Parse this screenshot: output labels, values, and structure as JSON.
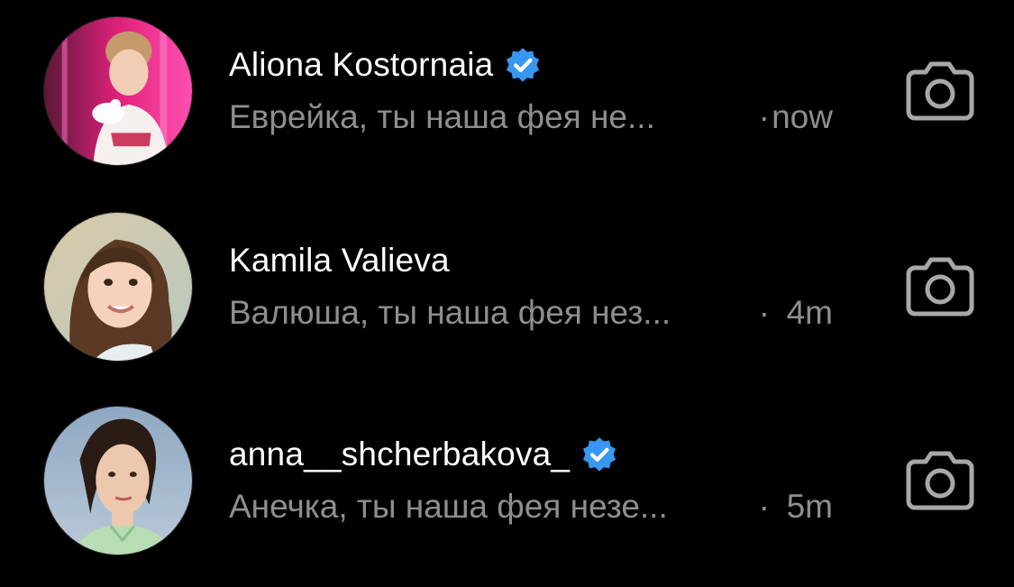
{
  "threads": [
    {
      "name": "Aliona Kostornaia",
      "verified": true,
      "preview": "Еврейка, ты наша фея не...",
      "separator": "·",
      "time": "now",
      "camera_icon": "camera-icon"
    },
    {
      "name": "Kamila Valieva",
      "verified": false,
      "preview": "Валюша, ты наша фея нез...",
      "separator": "·",
      "time": "4m",
      "camera_icon": "camera-icon"
    },
    {
      "name": "anna__shcherbakova_",
      "verified": true,
      "preview": "Анечка, ты наша фея незе...",
      "separator": "·",
      "time": "5m",
      "camera_icon": "camera-icon"
    }
  ],
  "colors": {
    "background": "#000000",
    "name": "#ffffff",
    "secondary": "#8e8e8e",
    "verified_badge": "#3897f0",
    "camera_icon": "#a8a8a8"
  }
}
